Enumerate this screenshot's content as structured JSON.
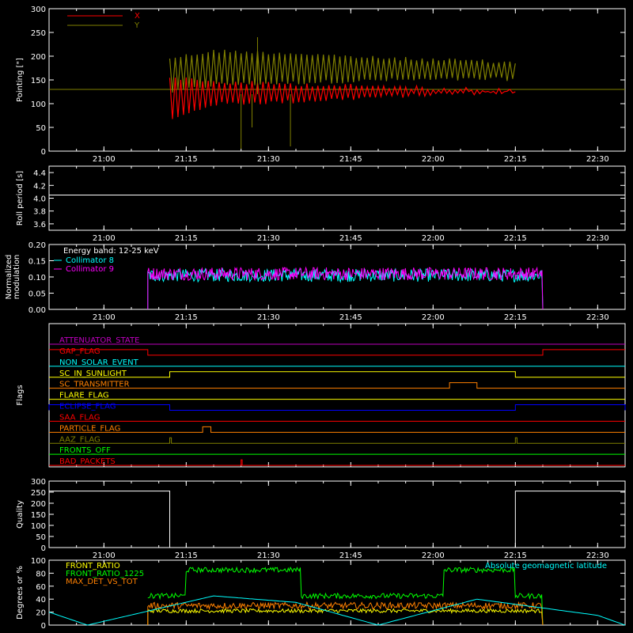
{
  "time_axis": {
    "start": "20:50",
    "end": "22:35",
    "ticks": [
      "21:00",
      "21:15",
      "21:30",
      "21:45",
      "22:00",
      "22:15",
      "22:30"
    ]
  },
  "colors": {
    "axis": "#ffffff",
    "x": "#ff0000",
    "y": "#808000",
    "cyan": "#00ffff",
    "magenta": "#ff00ff",
    "orange": "#ff8000",
    "yellow": "#ffff00",
    "green": "#00ff00",
    "blue": "#0000ff",
    "purple": "#c000c0",
    "red": "#ff0000",
    "olive": "#808000",
    "white": "#ffffff"
  },
  "chart_data": [
    {
      "type": "line",
      "id": "pointing",
      "ylabel": "Pointing [\"]",
      "ylim": [
        0,
        300
      ],
      "yticks": [
        "0",
        "50",
        "100",
        "150",
        "200",
        "250",
        "300"
      ],
      "legend": [
        "X",
        "Y"
      ],
      "reference_y": 130,
      "series": [
        {
          "name": "X",
          "color": "#ff0000",
          "t": [
            "21:12",
            "21:20",
            "21:35",
            "21:50",
            "22:05",
            "22:15"
          ],
          "low": [
            60,
            95,
            100,
            110,
            118,
            120
          ],
          "high": [
            160,
            150,
            145,
            140,
            135,
            132
          ]
        },
        {
          "name": "Y",
          "color": "#808000",
          "t": [
            "21:12",
            "21:20",
            "21:35",
            "21:50",
            "22:05",
            "22:15"
          ],
          "low": [
            120,
            135,
            140,
            145,
            147,
            148
          ],
          "high": [
            200,
            215,
            210,
            200,
            195,
            190
          ]
        }
      ],
      "spikes": [
        {
          "t": "21:25",
          "value": 5
        },
        {
          "t": "21:27",
          "value": 50
        },
        {
          "t": "21:28",
          "value": 240
        },
        {
          "t": "21:34",
          "value": 10
        }
      ]
    },
    {
      "type": "line",
      "id": "roll",
      "ylabel": "Roll period [s]",
      "ylim": [
        3.5,
        4.5
      ],
      "yticks": [
        "3.6",
        "3.8",
        "4.0",
        "4.2",
        "4.4"
      ],
      "series": [
        {
          "name": "",
          "t": [
            "20:50",
            "22:35"
          ],
          "values": [
            4.05,
            4.05
          ]
        }
      ]
    },
    {
      "type": "line",
      "id": "modulation",
      "ylabel": "Normalized modulation",
      "ylim": [
        0,
        0.2
      ],
      "yticks": [
        "0.00",
        "0.05",
        "0.10",
        "0.15",
        "0.20"
      ],
      "annotation": "Energy band: 12-25 keV",
      "legend": [
        "Collimator 8",
        "Collimator 9"
      ],
      "series": [
        {
          "name": "Collimator 8",
          "color": "#00ffff",
          "start": "21:08",
          "end": "22:20",
          "mean": 0.105,
          "spread": 0.02
        },
        {
          "name": "Collimator 9",
          "color": "#ff00ff",
          "start": "21:08",
          "end": "22:20",
          "mean": 0.11,
          "spread": 0.02
        }
      ]
    },
    {
      "type": "line",
      "id": "flags",
      "ylabel": "Flags",
      "flags": [
        {
          "label": "ATTENUATOR_STATE",
          "color": "#c000c0",
          "segments": []
        },
        {
          "label": "GAP_FLAG",
          "color": "#ff0000",
          "segments": [
            [
              "20:50",
              "21:08",
              0
            ],
            [
              "21:08",
              "22:20",
              0
            ],
            [
              "22:20",
              "22:35",
              1
            ]
          ],
          "initial": 1
        },
        {
          "label": "NON_SOLAR_EVENT",
          "color": "#00ffff",
          "segments": []
        },
        {
          "label": "SC_IN_SUNLIGHT",
          "color": "#ffff00",
          "high": [
            [
              "21:12",
              "22:15"
            ]
          ]
        },
        {
          "label": "SC_TRANSMITTER",
          "color": "#ff8000",
          "high": [
            [
              "22:03",
              "22:08"
            ]
          ]
        },
        {
          "label": "FLARE_FLAG",
          "color": "#ffff00",
          "high": []
        },
        {
          "label": "ECLIPSE_FLAG",
          "color": "#0000ff",
          "high": [
            [
              "20:50",
              "21:12"
            ],
            [
              "22:15",
              "22:35"
            ]
          ]
        },
        {
          "label": "SAA_FLAG",
          "color": "#ff0000",
          "high": []
        },
        {
          "label": "PARTICLE_FLAG",
          "color": "#ff8000",
          "high": [
            [
              "21:18",
              "21:19.5"
            ]
          ]
        },
        {
          "label": "AAZ_FLAG",
          "color": "#808000",
          "high": [
            [
              "21:12",
              "21:12.3"
            ],
            [
              "22:15",
              "22:15.3"
            ]
          ]
        },
        {
          "label": "FRONTS_OFF",
          "color": "#00ff00",
          "high": []
        },
        {
          "label": "BAD_PACKETS",
          "color": "#ff0000",
          "high": [
            [
              "21:25",
              "21:25.2"
            ]
          ]
        }
      ]
    },
    {
      "type": "line",
      "id": "quality",
      "ylabel": "Quality",
      "ylim": [
        0,
        300
      ],
      "yticks": [
        "0",
        "50",
        "100",
        "150",
        "200",
        "250",
        "300"
      ],
      "series": [
        {
          "name": "",
          "t": [
            "20:50",
            "21:12",
            "21:12",
            "22:15",
            "22:15",
            "22:35"
          ],
          "values": [
            255,
            255,
            0,
            0,
            255,
            255
          ]
        }
      ]
    },
    {
      "type": "line",
      "id": "degrees",
      "ylabel": "Degrees or %",
      "ylim": [
        0,
        100
      ],
      "yticks": [
        "0",
        "20",
        "40",
        "60",
        "80",
        "100"
      ],
      "legend": [
        "FRONT_RATIO",
        "FRONT_RATIO_1225",
        "MAX_DET_VS_TOT"
      ],
      "legend_right": "Absolute geomagnetic latitude",
      "series": [
        {
          "name": "FRONT_RATIO",
          "color": "#ffff00",
          "start": "21:08",
          "end": "22:20",
          "mean": 22,
          "spread": 3
        },
        {
          "name": "FRONT_RATIO_1225",
          "color": "#00ff00",
          "segments": [
            [
              "21:08",
              "21:15",
              45
            ],
            [
              "21:15",
              "21:36",
              85
            ],
            [
              "21:36",
              "22:02",
              45
            ],
            [
              "22:02",
              "22:15",
              85
            ],
            [
              "22:15",
              "22:20",
              45
            ]
          ],
          "spread": 4
        },
        {
          "name": "MAX_DET_VS_TOT",
          "color": "#ff8000",
          "start": "21:08",
          "end": "22:20",
          "mean": 30,
          "spread": 5
        },
        {
          "name": "Absolute geomagnetic latitude",
          "color": "#00ffff",
          "t": [
            "20:50",
            "20:57",
            "21:20",
            "21:35",
            "21:50",
            "22:08",
            "22:30",
            "22:35"
          ],
          "values": [
            20,
            0,
            45,
            35,
            0,
            40,
            15,
            0
          ]
        }
      ]
    }
  ]
}
